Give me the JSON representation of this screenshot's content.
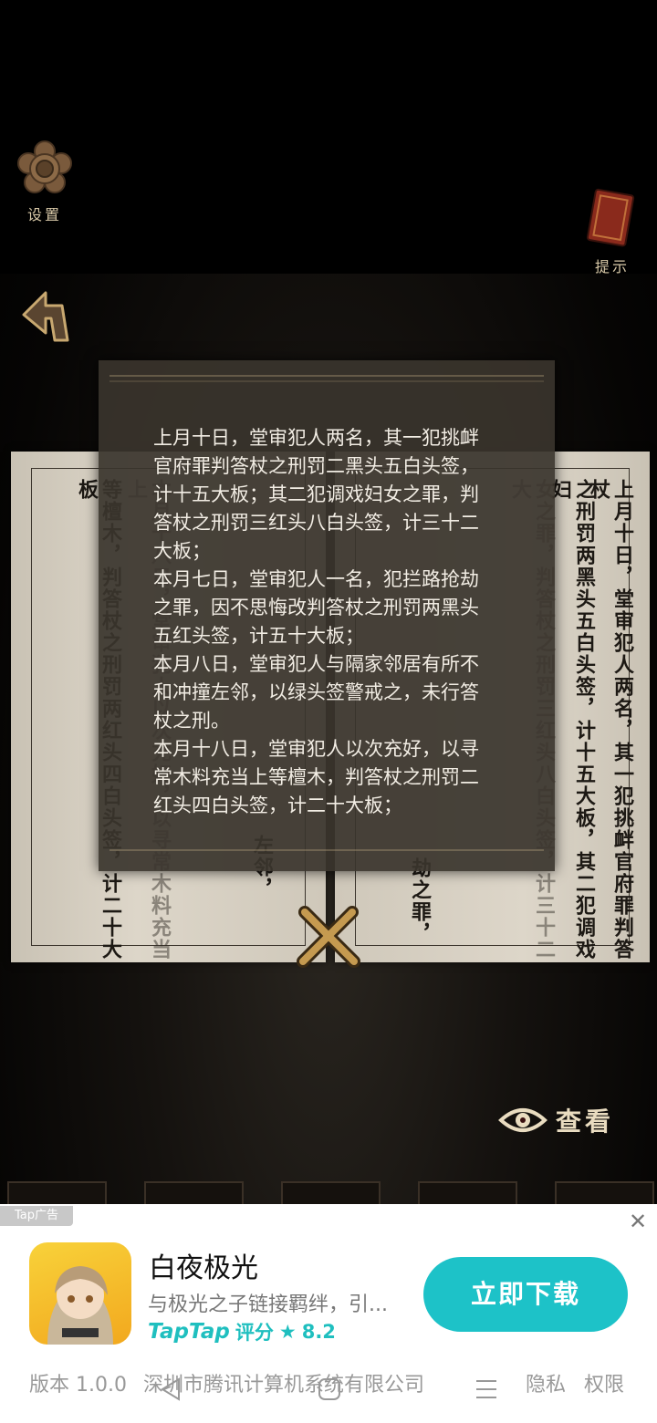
{
  "hud": {
    "settings_label": "设置",
    "hint_label": "提示",
    "view_label": "查看"
  },
  "book": {
    "left_page_columns": [
      "等檀木，判答杖之刑罚两红头四白头签，计二十大板",
      "本月十八日，堂审犯人以次充好，以寻常木料充当上",
      "左邻，",
      "位邻，因不思"
    ],
    "right_page_columns": [
      "上月十日，堂审犯人两名，其一犯挑衅官府罪判答杖",
      "之刑罚两黑头五白头签，计十五大板，其二犯调戏妇",
      "女之罪，判答杖之刑罚三红头八白头签，计三十二大",
      "劫之罪，"
    ]
  },
  "note": {
    "text": "上月十日，堂审犯人两名，其一犯挑衅官府罪判答杖之刑罚二黑头五白头签，计十五大板；其二犯调戏妇女之罪，判答杖之刑罚三红头八白头签，计三十二大板；\n本月七日，堂审犯人一名，犯拦路抢劫之罪，因不思悔改判答杖之刑罚两黑头五红头签，计五十大板；\n本月八日，堂审犯人与隔家邻居有所不和冲撞左邻，以绿头签警戒之，未行答杖之刑。\n本月十八日，堂审犯人以次充好，以寻常木料充当上等檀木，判答杖之刑罚二红头四白头签，计二十大板；"
  },
  "ad": {
    "tag": "Tap广告",
    "app_name": "白夜极光",
    "description": "与极光之子链接羁绊，引...",
    "brand": "TapTap",
    "rating_label": "评分",
    "rating_value": "8.2",
    "download_label": "立即下载",
    "version": "版本 1.0.0",
    "company": "深圳市腾讯计算机系统有限公司",
    "privacy": "隐私",
    "permissions": "权限"
  },
  "icons": [
    "settings-gear-icon",
    "hint-book-icon",
    "back-arrow-icon",
    "close-x-icon",
    "eye-icon",
    "ad-close-icon",
    "star-icon",
    "nav-back-icon",
    "nav-home-icon",
    "nav-menu-icon"
  ]
}
